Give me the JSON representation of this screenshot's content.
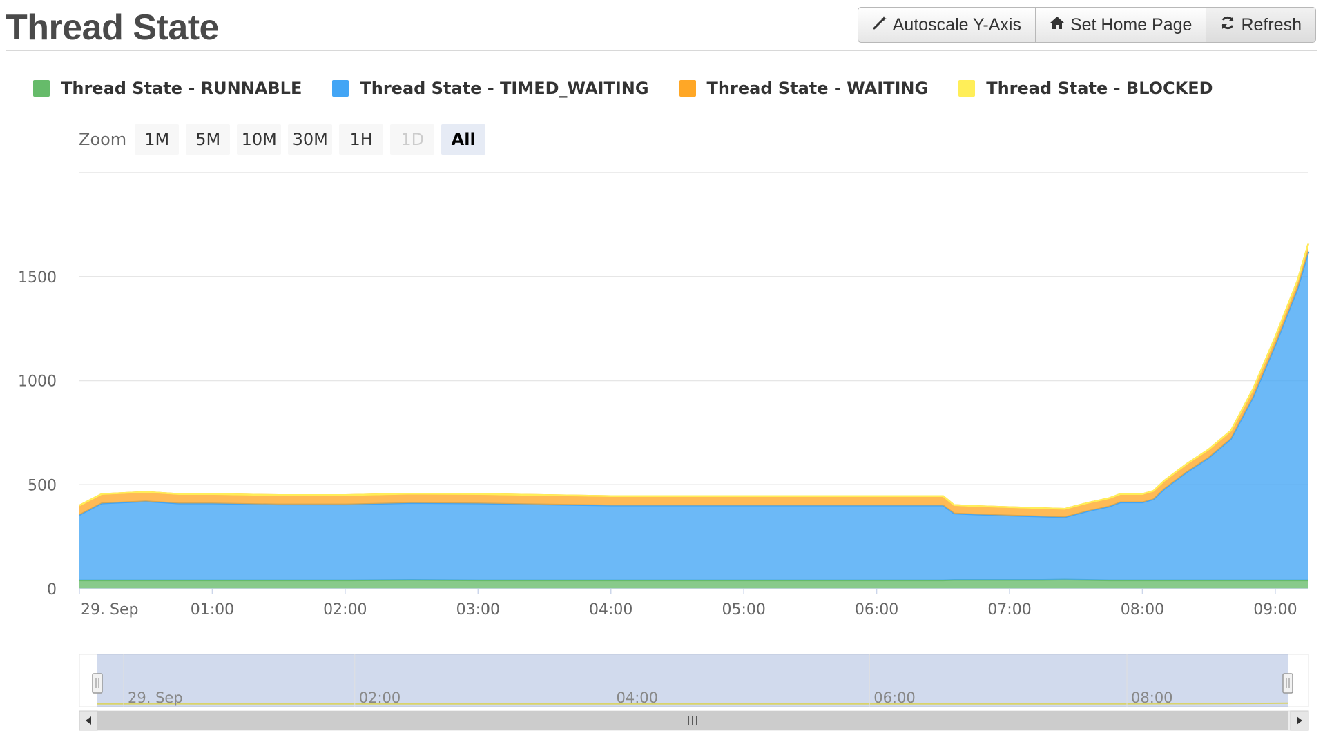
{
  "page": {
    "title": "Thread State"
  },
  "toolbar": {
    "autoscale_label": "Autoscale Y-Axis",
    "home_label": "Set Home Page",
    "refresh_label": "Refresh"
  },
  "zoom": {
    "label": "Zoom",
    "buttons": [
      {
        "label": "1M",
        "state": "normal"
      },
      {
        "label": "5M",
        "state": "normal"
      },
      {
        "label": "10M",
        "state": "normal"
      },
      {
        "label": "30M",
        "state": "normal"
      },
      {
        "label": "1H",
        "state": "normal"
      },
      {
        "label": "1D",
        "state": "disabled"
      },
      {
        "label": "All",
        "state": "active"
      }
    ]
  },
  "chart_data": {
    "type": "area",
    "stacked": true,
    "title": "",
    "xlabel": "",
    "ylabel": "",
    "ylim": [
      0,
      2000
    ],
    "yticks": [
      0,
      500,
      1000,
      1500
    ],
    "xlim": [
      "00:00",
      "09:15"
    ],
    "xticks": [
      "29. Sep",
      "01:00",
      "02:00",
      "03:00",
      "04:00",
      "05:00",
      "06:00",
      "07:00",
      "08:00",
      "09:00"
    ],
    "grid": true,
    "legend_position": "top-left",
    "x": [
      "00:00",
      "00:10",
      "00:30",
      "00:45",
      "01:00",
      "01:30",
      "02:00",
      "02:30",
      "03:00",
      "03:30",
      "04:00",
      "04:30",
      "05:00",
      "05:30",
      "06:00",
      "06:30",
      "06:35",
      "06:45",
      "07:00",
      "07:15",
      "07:25",
      "07:35",
      "07:45",
      "07:50",
      "08:00",
      "08:05",
      "08:10",
      "08:20",
      "08:30",
      "08:40",
      "08:50",
      "09:00",
      "09:10",
      "09:15"
    ],
    "series": [
      {
        "name": "Thread State - RUNNABLE",
        "color": "#66bb6a",
        "values": [
          40,
          40,
          40,
          40,
          40,
          40,
          40,
          42,
          40,
          40,
          40,
          40,
          40,
          40,
          40,
          40,
          42,
          42,
          42,
          42,
          44,
          42,
          40,
          40,
          40,
          40,
          40,
          40,
          40,
          40,
          40,
          40,
          40,
          40
        ]
      },
      {
        "name": "Thread State - TIMED_WAITING",
        "color": "#42a5f5",
        "values": [
          315,
          370,
          380,
          370,
          370,
          365,
          365,
          370,
          370,
          365,
          360,
          360,
          360,
          360,
          360,
          360,
          320,
          315,
          310,
          305,
          300,
          330,
          355,
          375,
          375,
          390,
          440,
          520,
          590,
          680,
          880,
          1130,
          1400,
          1580
        ]
      },
      {
        "name": "Thread State - WAITING",
        "color": "#ffa726",
        "values": [
          45,
          45,
          45,
          45,
          45,
          45,
          45,
          45,
          45,
          45,
          45,
          45,
          45,
          45,
          45,
          45,
          40,
          40,
          40,
          40,
          40,
          40,
          40,
          40,
          40,
          40,
          40,
          40,
          40,
          40,
          40,
          40,
          40,
          40
        ]
      },
      {
        "name": "Thread State - BLOCKED",
        "color": "#ffee58",
        "values": [
          0,
          0,
          0,
          0,
          0,
          0,
          0,
          0,
          0,
          0,
          0,
          0,
          0,
          0,
          0,
          0,
          0,
          0,
          0,
          0,
          0,
          0,
          0,
          0,
          0,
          0,
          0,
          0,
          0,
          0,
          0,
          0,
          0,
          0
        ]
      }
    ],
    "navigator": {
      "xticks": [
        "29. Sep",
        "02:00",
        "04:00",
        "06:00",
        "08:00"
      ]
    }
  }
}
